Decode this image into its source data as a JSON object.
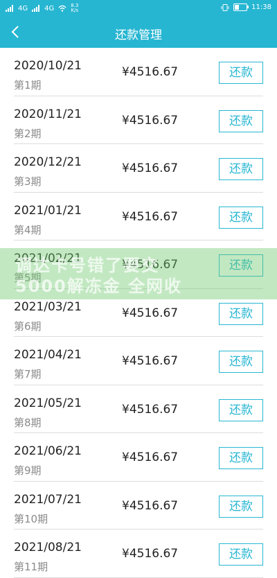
{
  "status": {
    "carrier1": "4G",
    "carrier2": "4G",
    "net_speed": "8.3\nK/s",
    "time": "11:38"
  },
  "header": {
    "title": "还款管理"
  },
  "watermark": {
    "line1": "调达卡号错了要交",
    "line2": "5000解冻金 全网收"
  },
  "list": {
    "items": [
      {
        "date": "2020/10/21",
        "period": "第1期",
        "amount": "¥4516.67",
        "button": "还款"
      },
      {
        "date": "2020/11/21",
        "period": "第2期",
        "amount": "¥4516.67",
        "button": "还款"
      },
      {
        "date": "2020/12/21",
        "period": "第3期",
        "amount": "¥4516.67",
        "button": "还款"
      },
      {
        "date": "2021/01/21",
        "period": "第4期",
        "amount": "¥4516.67",
        "button": "还款"
      },
      {
        "date": "2021/02/21",
        "period": "第5期",
        "amount": "¥4516.67",
        "button": "还款"
      },
      {
        "date": "2021/03/21",
        "period": "第6期",
        "amount": "¥4516.67",
        "button": "还款"
      },
      {
        "date": "2021/04/21",
        "period": "第7期",
        "amount": "¥4516.67",
        "button": "还款"
      },
      {
        "date": "2021/05/21",
        "period": "第8期",
        "amount": "¥4516.67",
        "button": "还款"
      },
      {
        "date": "2021/06/21",
        "period": "第9期",
        "amount": "¥4516.67",
        "button": "还款"
      },
      {
        "date": "2021/07/21",
        "period": "第10期",
        "amount": "¥4516.67",
        "button": "还款"
      },
      {
        "date": "2021/08/21",
        "period": "第11期",
        "amount": "¥4516.67",
        "button": "还款"
      }
    ]
  }
}
